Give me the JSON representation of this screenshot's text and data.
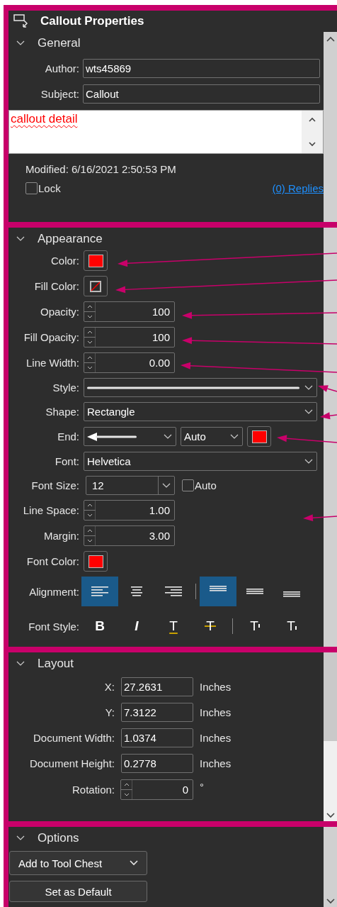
{
  "panel": {
    "title": "Callout Properties"
  },
  "general": {
    "title": "General",
    "expanded": true,
    "fields": [
      {
        "label": "Author:",
        "value": "wts45869"
      },
      {
        "label": "Subject:",
        "value": "Callout"
      }
    ],
    "comment": "callout detail",
    "modified": "Modified: 6/16/2021 2:50:53 PM",
    "lock": {
      "label": "Lock",
      "checked": false
    },
    "replies": "(0) Replies"
  },
  "appearance": {
    "title": "Appearance",
    "expanded": true,
    "rows": [
      {
        "kind": "swatch",
        "label": "Color:",
        "color": "#ff0000"
      },
      {
        "kind": "no_color",
        "label": "Fill Color:"
      },
      {
        "kind": "spin",
        "label": "Opacity:",
        "value": "100"
      },
      {
        "kind": "spin",
        "label": "Fill Opacity:",
        "value": "100"
      },
      {
        "kind": "spin",
        "label": "Line Width:",
        "value": "0.00"
      },
      {
        "kind": "line_style",
        "label": "Style:"
      },
      {
        "kind": "select",
        "label": "Shape:",
        "value": "Rectangle"
      },
      {
        "kind": "end",
        "label": "End:",
        "value": "Auto",
        "color": "#ff0000"
      },
      {
        "kind": "select",
        "label": "Font:",
        "value": "Helvetica"
      },
      {
        "kind": "font_size",
        "label": "Font Size:",
        "value": "12",
        "auto": {
          "label": "Auto",
          "checked": false
        }
      },
      {
        "kind": "spin",
        "label": "Line Space:",
        "value": "1.00"
      },
      {
        "kind": "spin",
        "label": "Margin:",
        "value": "3.00"
      },
      {
        "kind": "swatch",
        "label": "Font Color:",
        "color": "#ff0000"
      },
      {
        "kind": "alignment",
        "label": "Alignment:",
        "horizontal": [
          {
            "selected": true
          },
          {
            "selected": false
          },
          {
            "selected": false
          }
        ],
        "vertical": [
          {
            "selected": true
          },
          {
            "selected": false
          },
          {
            "selected": false
          }
        ]
      },
      {
        "kind": "font_style",
        "label": "Font Style:",
        "buttons": [
          {
            "kind": "bold",
            "text": "B"
          },
          {
            "kind": "italic",
            "text": "I"
          },
          {
            "kind": "underline",
            "text": "T"
          },
          {
            "kind": "strike",
            "text": "T"
          },
          {
            "kind": "superscript",
            "text": "T"
          },
          {
            "kind": "subscript",
            "text": "T"
          }
        ]
      }
    ]
  },
  "layout": {
    "title": "Layout",
    "expanded": true,
    "rows": [
      {
        "kind": "text",
        "label": "X:",
        "value": "27.2631",
        "unit": "Inches"
      },
      {
        "kind": "text",
        "label": "Y:",
        "value": "7.3122",
        "unit": "Inches"
      },
      {
        "kind": "text",
        "label": "Document Width:",
        "value": "1.0374",
        "unit": "Inches"
      },
      {
        "kind": "text",
        "label": "Document Height:",
        "value": "0.2778",
        "unit": "Inches"
      },
      {
        "kind": "spin",
        "label": "Rotation:",
        "value": "0",
        "unit": "°"
      }
    ]
  },
  "options": {
    "title": "Options",
    "expanded": true,
    "dropdown": "Add to Tool Chest",
    "button": "Set as Default"
  }
}
